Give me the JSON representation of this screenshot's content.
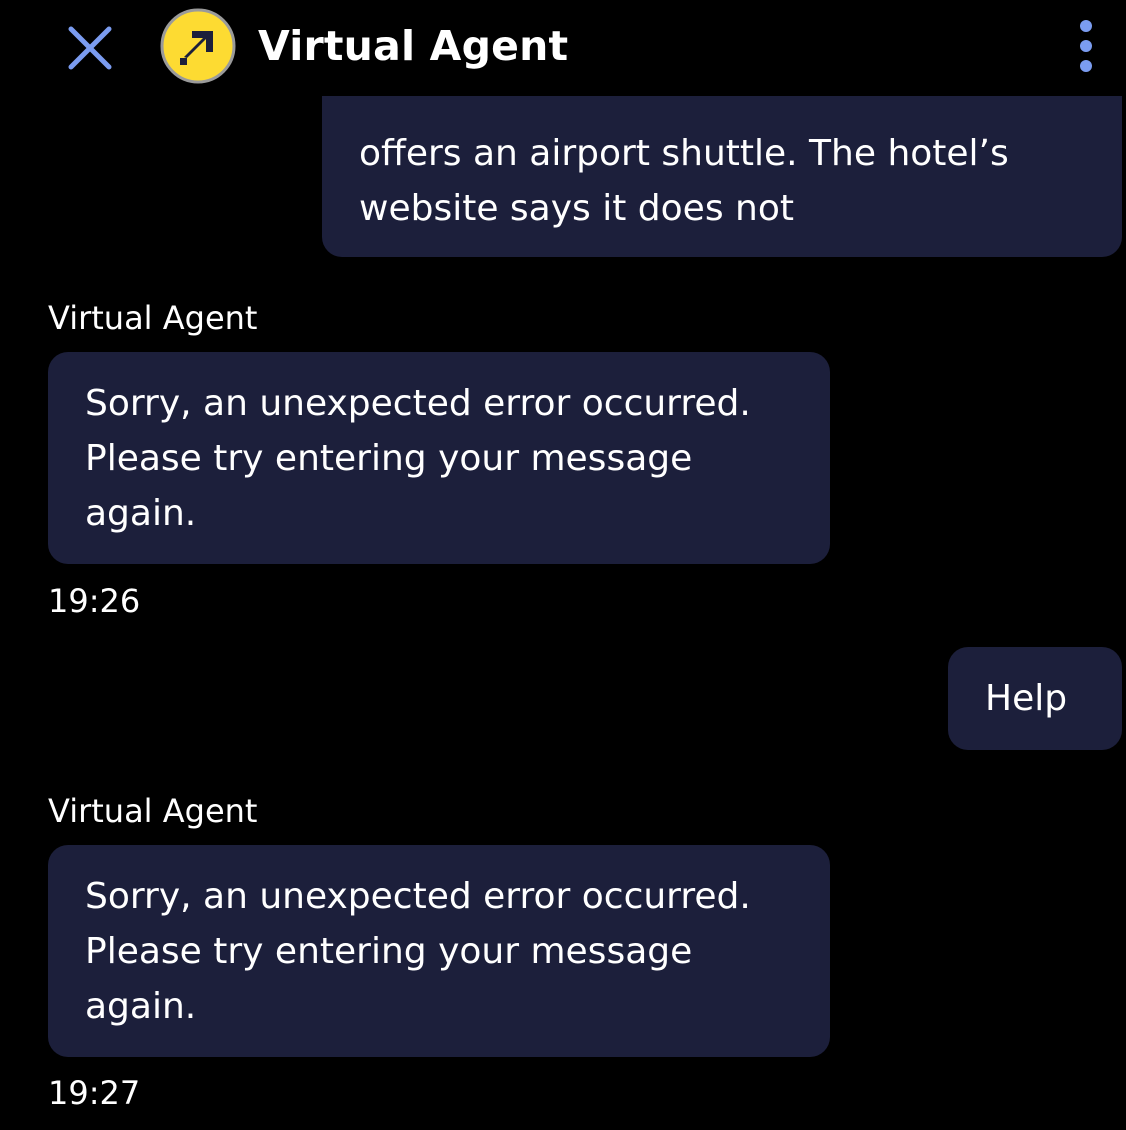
{
  "header": {
    "title": "Virtual Agent",
    "close_icon": "close-icon",
    "logo_icon": "expedia-logo",
    "menu_icon": "more-vertical-icon"
  },
  "colors": {
    "background": "#000000",
    "bubble": "#1c1f3b",
    "accent": "#7b9cf0",
    "logo_yellow": "#fddb32"
  },
  "messages": [
    {
      "sender": "user",
      "lines": [
        "offers an airport shuttle. The hotel’s",
        "website says it does not"
      ]
    },
    {
      "sender": "agent",
      "sender_label": "Virtual Agent",
      "lines": [
        "Sorry, an unexpected error occurred.",
        "Please try entering your message",
        "again."
      ],
      "time": "19:26"
    },
    {
      "sender": "user",
      "lines": [
        "Help"
      ]
    },
    {
      "sender": "agent",
      "sender_label": "Virtual Agent",
      "lines": [
        "Sorry, an unexpected error occurred.",
        "Please try entering your message",
        "again."
      ],
      "time": "19:27"
    }
  ]
}
